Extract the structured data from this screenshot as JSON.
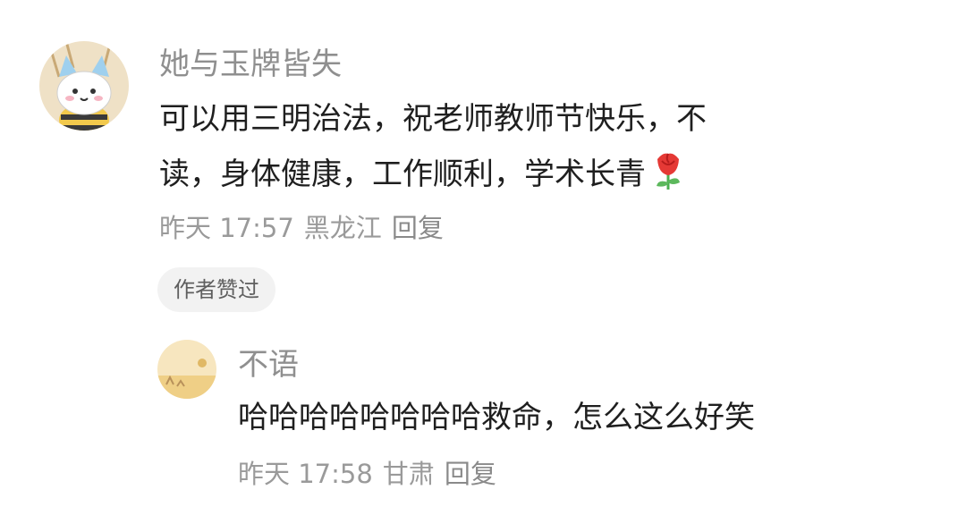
{
  "comment": {
    "username": "她与玉牌皆失",
    "text_line1": "可以用三明治法，祝老师教师节快乐，不",
    "text_line2": "读，身体健康，工作顺利，学术长青",
    "emoji": "rose",
    "meta": {
      "time": "昨天 17:57",
      "location": "黑龙江",
      "reply": "回复"
    },
    "badge": "作者赞过"
  },
  "reply": {
    "username": "不语",
    "text": "哈哈哈哈哈哈哈哈救命，怎么这么好笑",
    "meta": {
      "time": "昨天 17:58",
      "location": "甘肃",
      "reply": "回复"
    }
  },
  "colors": {
    "username": "#8f8f8f",
    "text": "#1f1f1f",
    "meta": "#9a9a9a",
    "badge_bg": "#f2f2f2"
  }
}
